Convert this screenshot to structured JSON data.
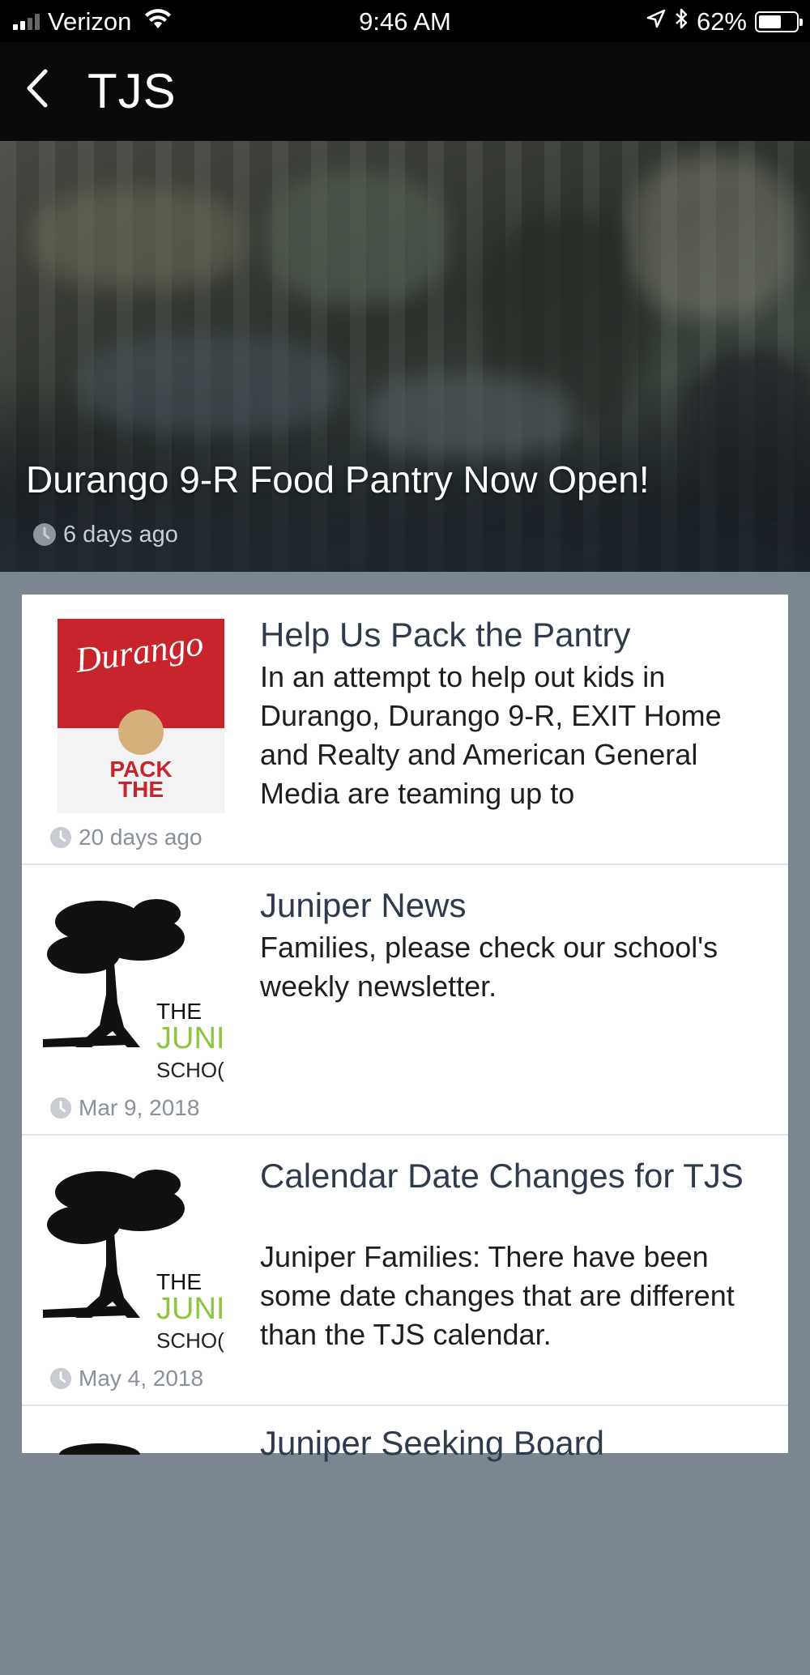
{
  "status_bar": {
    "carrier": "Verizon",
    "time": "9:46 AM",
    "battery_percent": "62%",
    "battery_level": 0.62,
    "icons": [
      "signal-icon",
      "wifi-icon",
      "location-icon",
      "bluetooth-icon",
      "battery-icon"
    ]
  },
  "nav": {
    "title": "TJS",
    "back_icon": "chevron-left-icon"
  },
  "featured": {
    "title": "Durango 9-R Food Pantry Now Open!",
    "time": "6 days ago"
  },
  "articles": [
    {
      "title": "Help Us Pack the Pantry",
      "body": "In an attempt to help out kids in Durango, Durango 9-R, EXIT Home and Realty and American General Media are teaming up to",
      "time": "20 days ago",
      "thumb": {
        "type": "can",
        "brand": "Durango",
        "text_line1": "PACK",
        "text_line2": "THE",
        "colors": {
          "red": "#c8242b",
          "label": "#d6b07a"
        }
      }
    },
    {
      "title": "Juniper News",
      "body": "Families, please check our school's weekly newsletter.",
      "time": "Mar 9, 2018",
      "thumb": {
        "type": "tree",
        "line1": "THE",
        "line2": "JUNI",
        "line3": "SCHO(",
        "colors": {
          "green": "#8cc63f"
        }
      }
    },
    {
      "title": "Calendar Date Changes for TJS",
      "body": "Juniper Families: There have been some date changes that are different than the TJS calendar.",
      "time": "May 4, 2018",
      "thumb": {
        "type": "tree",
        "line1": "THE",
        "line2": "JUNI",
        "line3": "SCHO(",
        "colors": {
          "green": "#8cc63f"
        }
      }
    },
    {
      "title": "Juniper Seeking Board"
    }
  ]
}
